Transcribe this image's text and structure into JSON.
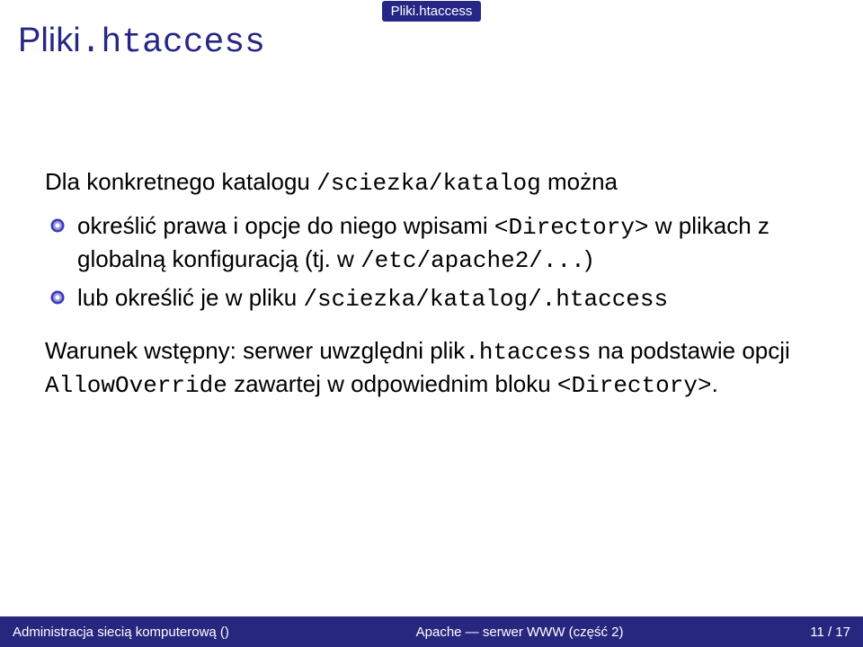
{
  "header": {
    "section": "Pliki.htaccess"
  },
  "slide": {
    "title_plain": "Pliki",
    "title_mono": ".htaccess"
  },
  "body": {
    "intro_pre": "Dla konkretnego katalogu ",
    "intro_path": "/sciezka/katalog",
    "intro_post": " można",
    "bullets": [
      {
        "pre1": "określić prawa i opcje do niego wpisami ",
        "mono1": "<Directory>",
        "mid1": " w plikach z globalną konfiguracją (tj. w ",
        "mono2": "/etc/apache2/...",
        "post1": ")"
      },
      {
        "pre1": "lub określić je w pliku ",
        "mono1": "/sciezka/katalog/.htaccess",
        "mid1": "",
        "mono2": "",
        "post1": ""
      }
    ],
    "para2_pre": "Warunek wstępny: serwer uwzględni plik",
    "para2_mono1": ".htaccess",
    "para2_mid": " na podstawie opcji ",
    "para2_mono2": "AllowOverride",
    "para2_mid2": " zawartej w odpowiednim bloku ",
    "para2_mono3": "<Directory>",
    "para2_post": "."
  },
  "footer": {
    "left": "Administracja siecią komputerową ()",
    "center": "Apache — serwer WWW (część 2)",
    "right": "11 / 17"
  },
  "colors": {
    "brand": "#262686",
    "footer_bg": "#27277f"
  }
}
